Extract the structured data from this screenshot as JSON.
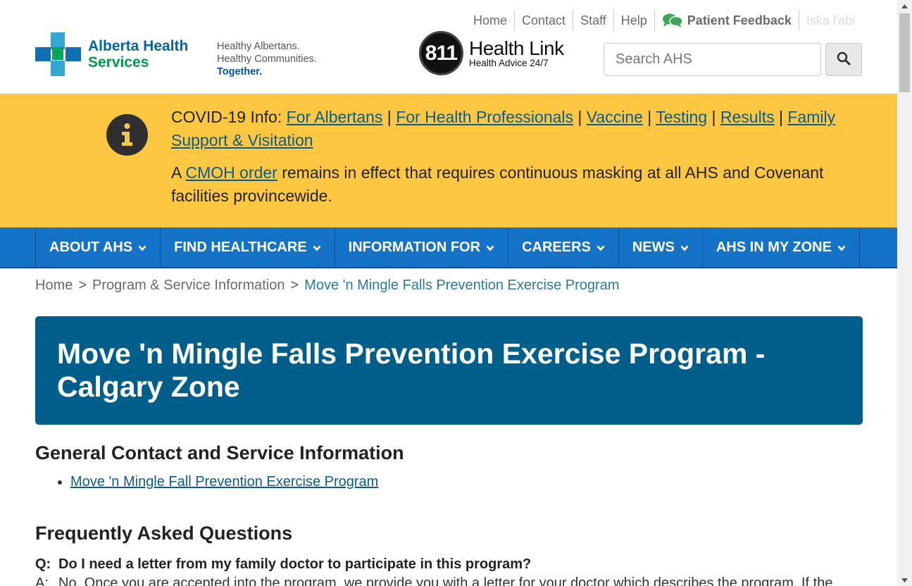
{
  "utility_nav": {
    "home": "Home",
    "contact": "Contact",
    "staff": "Staff",
    "help": "Help",
    "feedback": "Patient Feedback",
    "language": "Iska l'abi"
  },
  "logo": {
    "line1": "Alberta Health",
    "line2": "Services"
  },
  "tagline": {
    "line1": "Healthy Albertans.",
    "line2": "Healthy Communities.",
    "line3": "Together."
  },
  "healthlink": {
    "number": "811",
    "title": "Health Link",
    "subtitle": "Health Advice 24/7"
  },
  "search": {
    "placeholder": "Search AHS"
  },
  "alert": {
    "prefix": "COVID-19 Info:",
    "links": [
      "For Albertans",
      "For Health Professionals",
      "Vaccine",
      "Testing",
      "Results",
      "Family Support & Visitation"
    ],
    "separator": " | ",
    "notice_start": "A ",
    "notice_link": "CMOH order",
    "notice_end": " remains in effect that requires continuous masking at all AHS and Covenant facilities provincewide."
  },
  "nav": [
    "ABOUT AHS",
    "FIND HEALTHCARE",
    "INFORMATION FOR",
    "CAREERS",
    "NEWS",
    "AHS IN MY ZONE"
  ],
  "breadcrumb": {
    "home": "Home",
    "sep": ">",
    "section": "Program & Service Information",
    "current": "Move 'n Mingle Falls Prevention Exercise Program"
  },
  "page_title": "Move 'n Mingle Falls Prevention Exercise Program - Calgary Zone",
  "general_heading": "General Contact and Service Information",
  "general_link": "Move 'n Mingle Fall Prevention Exercise Program",
  "faq": {
    "heading": "Frequently Asked Questions",
    "q_label": "Q:",
    "question": "Do I need a letter from my family doctor to participate in this program?",
    "a_label": "A:",
    "answer": "No.  Once you are accepted into the program, we provide you with a letter for your doctor which describes the program. If the"
  },
  "colors": {
    "alert_bg": "#fdc741",
    "nav_bg": "#1472c7",
    "banner_bg": "#005f8a",
    "link": "#0a5b8e"
  }
}
